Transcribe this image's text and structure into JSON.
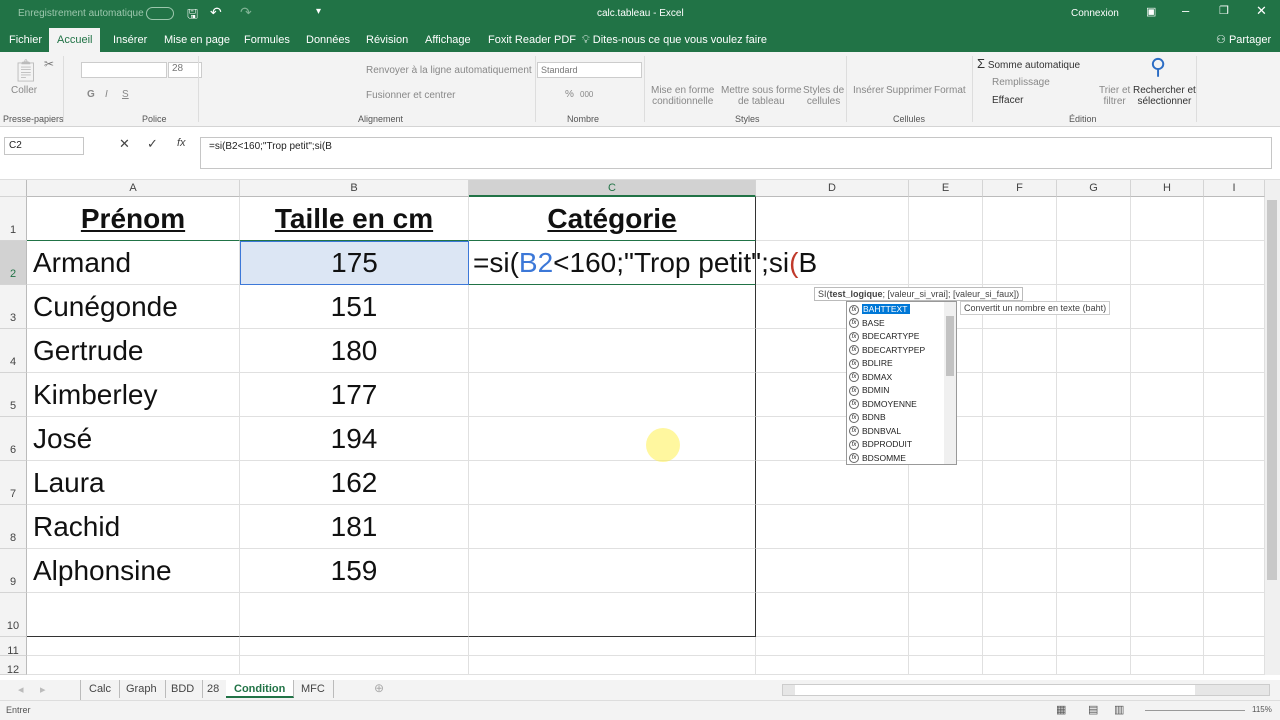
{
  "title": {
    "autosave": "Enregistrement automatique",
    "doc": "calc.tableau  -  Excel",
    "signin": "Connexion"
  },
  "tabs": [
    "Fichier",
    "Accueil",
    "Insérer",
    "Mise en page",
    "Formules",
    "Données",
    "Révision",
    "Affichage",
    "Foxit Reader PDF"
  ],
  "tell_me": "Dites-nous ce que vous voulez faire",
  "share": "Partager",
  "ribbon": {
    "paste": "Coller",
    "font_size": "28",
    "bold": "G",
    "italic": "I",
    "underline": "S",
    "wrap": "Renvoyer à la ligne automatiquement",
    "merge": "Fusionner et centrer",
    "number_format": "Standard",
    "percent": "%",
    "thousands": "000",
    "cond_format": [
      "Mise en forme",
      "conditionnelle"
    ],
    "table_format": [
      "Mettre sous forme",
      "de tableau"
    ],
    "cell_styles": [
      "Styles de",
      "cellules"
    ],
    "insert": "Insérer",
    "delete": "Supprimer",
    "format": "Format",
    "autosum": "Somme automatique",
    "fill": "Remplissage",
    "clear": "Effacer",
    "sort": [
      "Trier et",
      "filtrer"
    ],
    "find": [
      "Rechercher et",
      "sélectionner"
    ],
    "groups": [
      "Presse-papiers",
      "Police",
      "Alignement",
      "Nombre",
      "Styles",
      "Cellules",
      "Édition"
    ]
  },
  "formula_bar": {
    "name_box": "C2",
    "formula": "=si(B2<160;\"Trop petit\";si(B"
  },
  "columns": [
    "A",
    "B",
    "C",
    "D",
    "E",
    "F",
    "G",
    "H",
    "I"
  ],
  "rows": [
    "1",
    "2",
    "3",
    "4",
    "5",
    "6",
    "7",
    "8",
    "9",
    "10",
    "11",
    "12"
  ],
  "table": {
    "headers": [
      "Prénom",
      "Taille en cm",
      "Catégorie"
    ],
    "rows": [
      [
        "Armand",
        "175"
      ],
      [
        "Cunégonde",
        "151"
      ],
      [
        "Gertrude",
        "180"
      ],
      [
        "Kimberley",
        "177"
      ],
      [
        "José",
        "194"
      ],
      [
        "Laura",
        "162"
      ],
      [
        "Rachid",
        "181"
      ],
      [
        "Alphonsine",
        "159"
      ]
    ]
  },
  "editing": {
    "p1": "=si(",
    "ref": "B2",
    "p2": "<160;\"Trop petit\";si",
    "paren": "(",
    "p3": "B"
  },
  "tooltip": {
    "fn": "SI(",
    "arg1": "test_logique",
    "rest": "; [valeur_si_vrai]; [valeur_si_faux])"
  },
  "autocomplete": [
    "BAHTTEXT",
    "BASE",
    "BDECARTYPE",
    "BDECARTYPEP",
    "BDLIRE",
    "BDMAX",
    "BDMIN",
    "BDMOYENNE",
    "BDNB",
    "BDNBVAL",
    "BDPRODUIT",
    "BDSOMME"
  ],
  "autocomplete_desc": "Convertit un nombre en texte (baht)",
  "sheets": [
    "Calc",
    "Graph",
    "BDD",
    "28",
    "Condition",
    "MFC"
  ],
  "active_sheet": "Condition",
  "status": {
    "mode": "Entrer",
    "zoom": "115%"
  },
  "colors": {
    "excel_green": "#217346",
    "ref_blue": "#3c78d8",
    "selection": "#0078d7"
  }
}
